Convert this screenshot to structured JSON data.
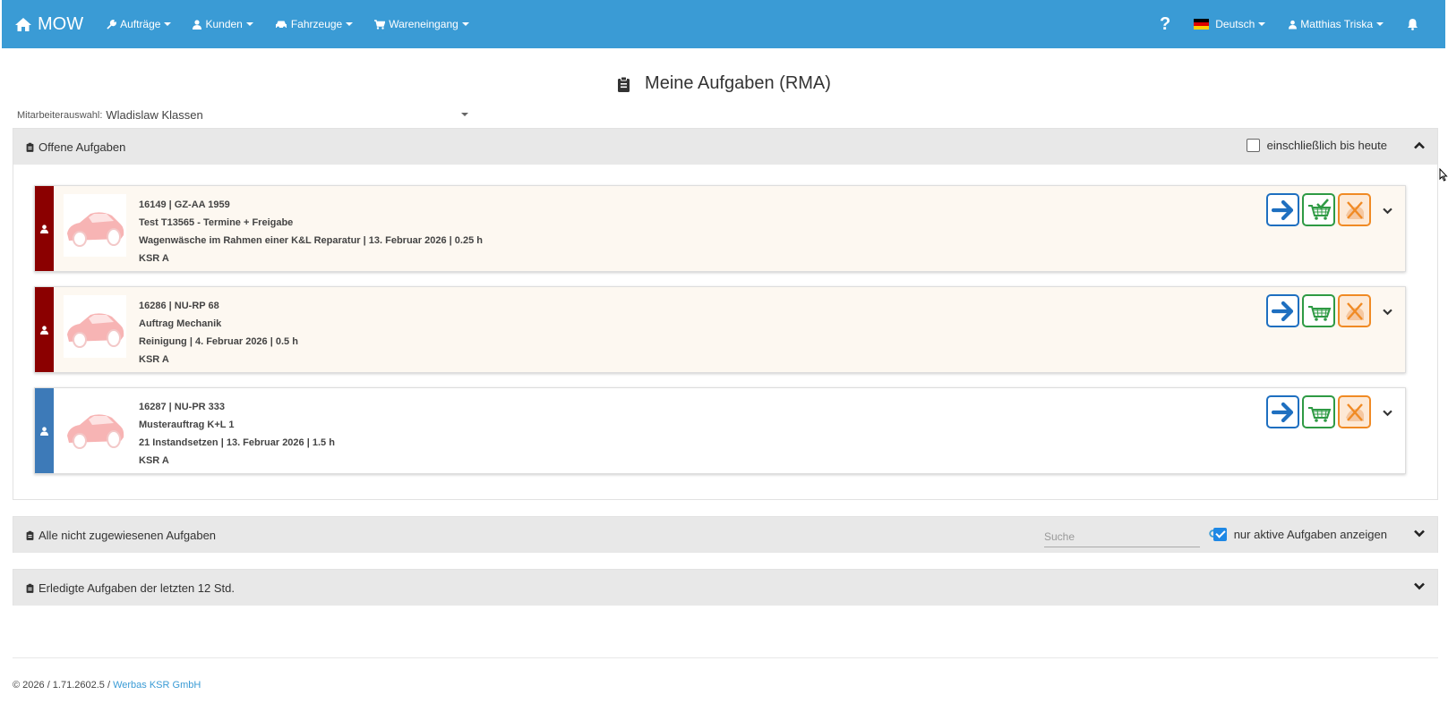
{
  "nav": {
    "brand": "MOW",
    "items": [
      {
        "label": "Aufträge",
        "icon": "wrench-icon"
      },
      {
        "label": "Kunden",
        "icon": "user-icon"
      },
      {
        "label": "Fahrzeuge",
        "icon": "car-icon"
      },
      {
        "label": "Wareneingang",
        "icon": "cart-icon"
      }
    ],
    "help": "?",
    "language": "Deutsch",
    "user": "Matthias Triska"
  },
  "page": {
    "title": "Meine Aufgaben (RMA)",
    "employee_label": "Mitarbeiterauswahl:",
    "employee_value": "Wladislaw Klassen"
  },
  "open_tasks": {
    "title": "Offene Aufgaben",
    "filter_label": "einschließlich bis heute",
    "filter_checked": false,
    "tasks": [
      {
        "line1": "16149 | GZ-AA 1959",
        "line2": "Test T13565 - Termine + Freigabe",
        "line3": "Wagenwäsche im Rahmen einer K&L Reparatur | 13. Februar 2026 | 0.25 h",
        "line4": "KSR A",
        "status_color": "#8b0000",
        "bg": "#fdf8f1",
        "cart_checked": true
      },
      {
        "line1": "16286 | NU-RP 68",
        "line2": "Auftrag Mechanik",
        "line3": "Reinigung | 4. Februar 2026 | 0.5 h",
        "line4": "KSR A",
        "status_color": "#8b0000",
        "bg": "#fdf8f1",
        "cart_checked": false
      },
      {
        "line1": "16287 | NU-PR 333",
        "line2": "Musterauftrag K+L 1",
        "line3": "21 Instandsetzen | 13. Februar 2026 | 1.5 h",
        "line4": "KSR A",
        "status_color": "#3d7ab8",
        "bg": "#ffffff",
        "cart_checked": false
      }
    ]
  },
  "unassigned": {
    "title": "Alle nicht zugewiesenen Aufgaben",
    "search_placeholder": "Suche",
    "filter_label": "nur aktive Aufgaben anzeigen",
    "filter_checked": true
  },
  "completed": {
    "title": "Erledigte Aufgaben der letzten 12 Std."
  },
  "footer": {
    "text": "© 2026 / 1.71.2602.5 / ",
    "link": "Werbas KSR GmbH"
  },
  "colors": {
    "navbar": "#3a9bd5",
    "accent_blue": "#1e6fc0",
    "accent_green": "#2e9a44",
    "accent_orange": "#f08a24"
  }
}
